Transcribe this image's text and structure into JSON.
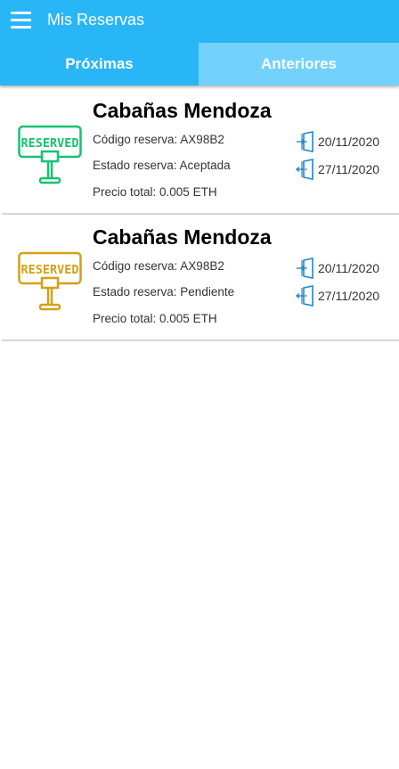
{
  "appbar": {
    "title": "Mis Reservas",
    "menu_icon": "hamburger-menu-icon"
  },
  "tabs": [
    {
      "label": "Próximas",
      "selected": true
    },
    {
      "label": "Anteriores",
      "selected": false
    }
  ],
  "colors": {
    "primary": "#29b6f6",
    "tab_inactive": "#73d2fb",
    "accepted_stamp": "#16c172",
    "pending_stamp": "#d4a017",
    "door_icon": "#1e88c8"
  },
  "stamp_label": "RESERVED",
  "reservations": [
    {
      "name": "Cabañas Mendoza",
      "code": "Código reserva: AX98B2",
      "status": "Estado reserva: Aceptada",
      "price": "Precio total: 0.005 ETH",
      "checkin": "20/11/2020",
      "checkout": "27/11/2020"
    },
    {
      "name": "Cabañas Mendoza",
      "code": "Código reserva: AX98B2",
      "status": "Estado reserva: Pendiente",
      "price": "Precio total: 0.005 ETH",
      "checkin": "20/11/2020",
      "checkout": "27/11/2020"
    }
  ]
}
